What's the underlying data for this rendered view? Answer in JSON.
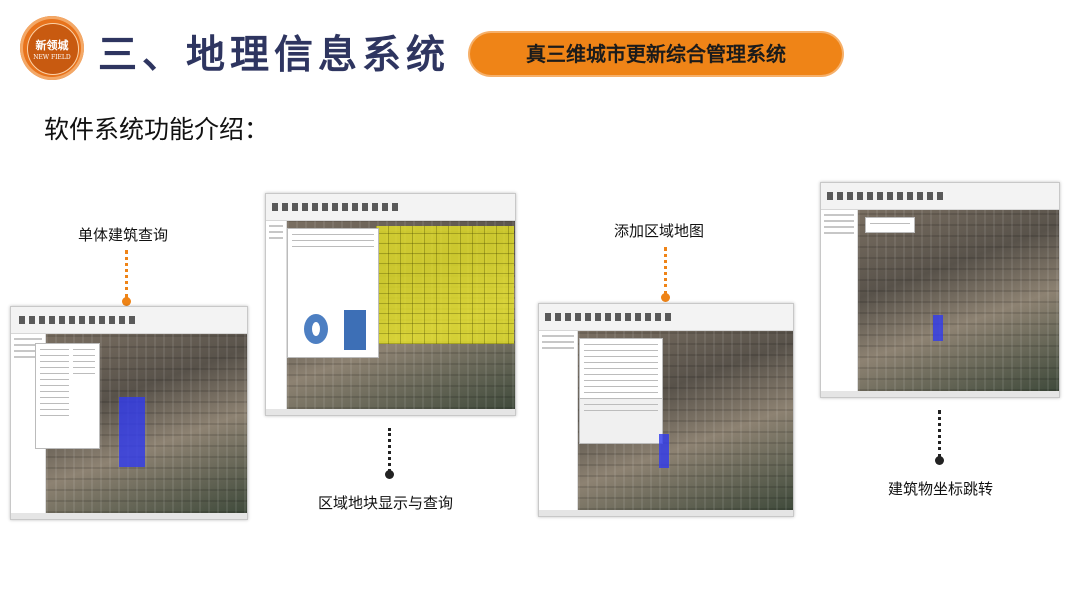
{
  "logo": {
    "name_cn": "新领城",
    "name_en": "NEW FIELD"
  },
  "header": {
    "title": "三、地理信息系统",
    "badge": "真三维城市更新综合管理系统"
  },
  "subtitle": "软件系统功能介绍：",
  "features": [
    {
      "label": "单体建筑查询"
    },
    {
      "label": "区域地块显示与查询"
    },
    {
      "label": "添加区域地图"
    },
    {
      "label": "建筑物坐标跳转"
    }
  ],
  "colors": {
    "brand_orange": "#ef8417",
    "title_navy": "#2e3560",
    "connector_dark": "#222222",
    "highlight_blue": "#3c46eb",
    "highlight_yellow": "#ece828"
  },
  "icons": [
    "logo-emblem-icon"
  ]
}
